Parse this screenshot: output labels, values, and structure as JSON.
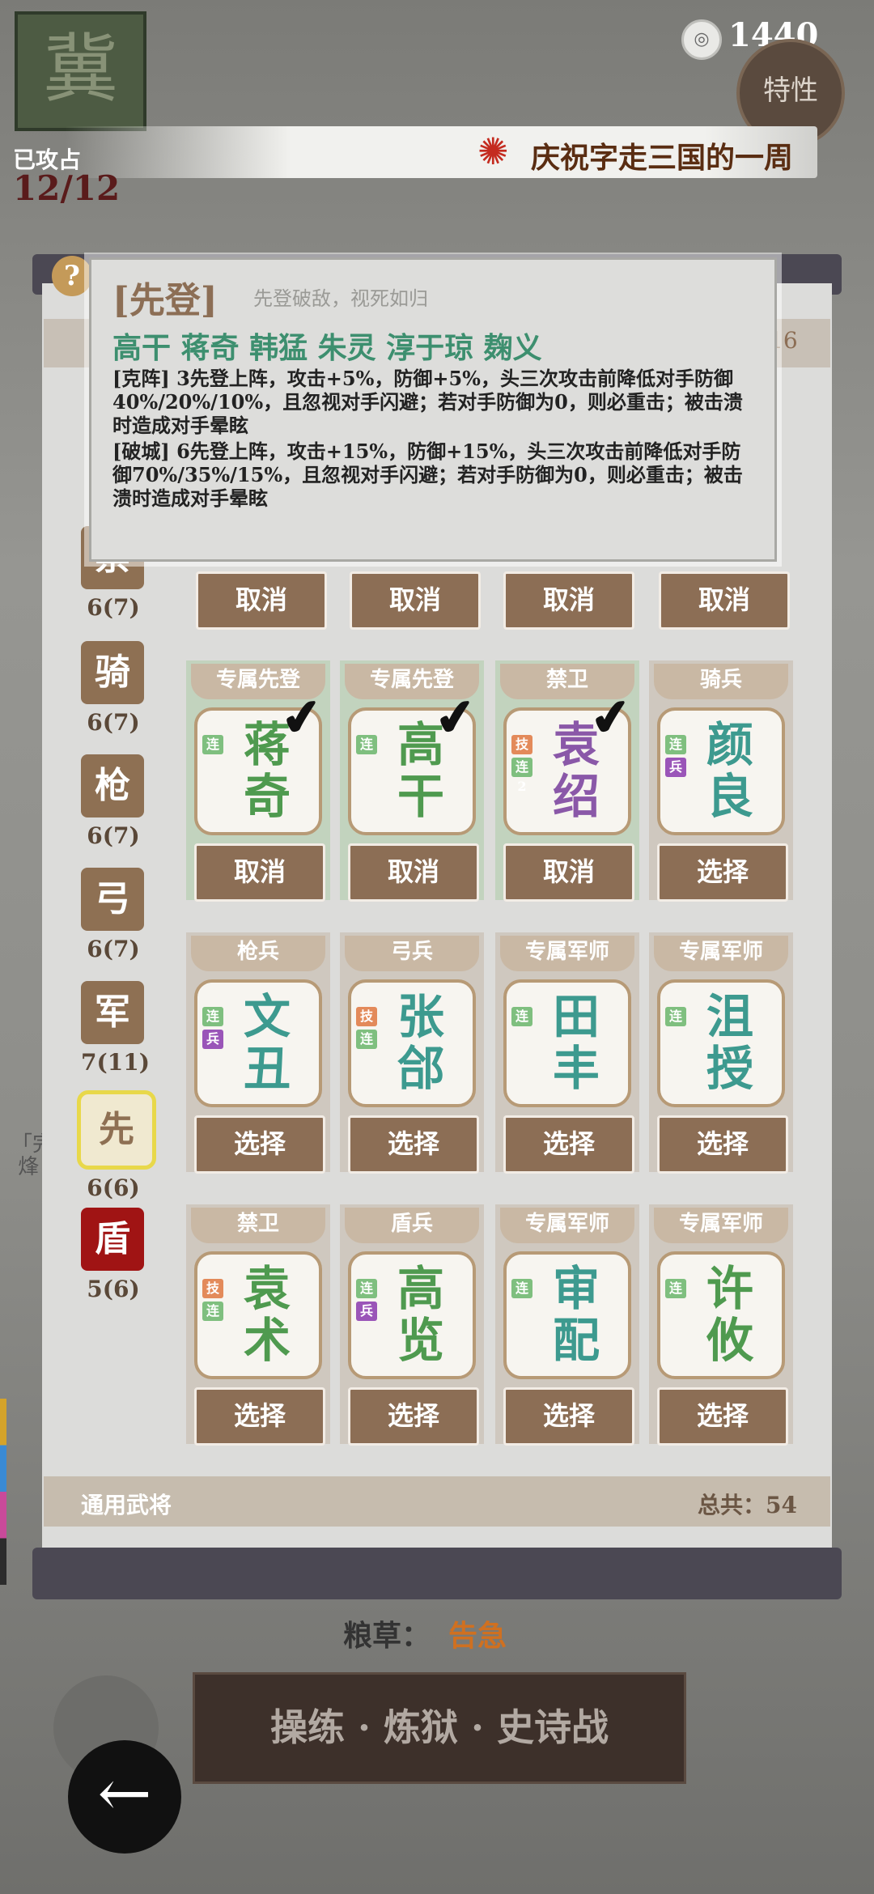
{
  "hud": {
    "city_glyph": "冀",
    "coin_icon": "coin-icon",
    "coin_value": "1440",
    "trait_label": "特性",
    "banner_text": "庆祝字走三国的一周",
    "attacked_label": "已攻占",
    "attacked_count": "12/12",
    "side_quest_text": "「完\n 烽"
  },
  "panel": {
    "help_glyph": "?",
    "top_bar_count": "16",
    "categories": [
      {
        "glyph": "禁",
        "count": "6(7)"
      },
      {
        "glyph": "骑",
        "count": "6(7)"
      },
      {
        "glyph": "枪",
        "count": "6(7)"
      },
      {
        "glyph": "弓",
        "count": "6(7)"
      },
      {
        "glyph": "军",
        "count": "7(11)"
      },
      {
        "glyph": "先",
        "count": "6(6)"
      },
      {
        "glyph": "盾",
        "count": "5(6)"
      }
    ],
    "hidden_row_buttons": [
      "取消",
      "取消",
      "取消",
      "取消"
    ],
    "cards": [
      {
        "tag": "专属先登",
        "name": "蒋奇",
        "badges": [
          "连"
        ],
        "button": "取消"
      },
      {
        "tag": "专属先登",
        "name": "高干",
        "badges": [
          "连"
        ],
        "button": "取消"
      },
      {
        "tag": "禁卫",
        "name": "袁绍",
        "badges": [
          "技",
          "连2"
        ],
        "button": "取消"
      },
      {
        "tag": "骑兵",
        "name": "颜良",
        "badges": [
          "连",
          "兵"
        ],
        "button": "选择"
      },
      {
        "tag": "枪兵",
        "name": "文丑",
        "badges": [
          "连",
          "兵"
        ],
        "button": "选择"
      },
      {
        "tag": "弓兵",
        "name": "张郃",
        "badges": [
          "技",
          "连"
        ],
        "button": "选择"
      },
      {
        "tag": "专属军师",
        "name": "田丰",
        "badges": [
          "连"
        ],
        "button": "选择"
      },
      {
        "tag": "专属军师",
        "name": "沮授",
        "badges": [
          "连"
        ],
        "button": "选择"
      },
      {
        "tag": "禁卫",
        "name": "袁术",
        "badges": [
          "技",
          "连"
        ],
        "button": "选择"
      },
      {
        "tag": "盾兵",
        "name": "高览",
        "badges": [
          "连",
          "兵"
        ],
        "button": "选择"
      },
      {
        "tag": "专属军师",
        "name": "审配",
        "badges": [
          "连"
        ],
        "button": "选择"
      },
      {
        "tag": "专属军师",
        "name": "许攸",
        "badges": [
          "连"
        ],
        "button": "选择"
      }
    ],
    "footer_left": "通用武将",
    "footer_right": "总共：54"
  },
  "tooltip": {
    "title": "[先登]",
    "subtitle": "先登破敌，视死如归",
    "generals": "高干 蒋奇 韩猛 朱灵 淳于琼 麹义",
    "para1": "[克阵] 3先登上阵，攻击+5%，防御+5%，头三次攻击前降低对手防御40%/20%/10%，且忽视对手闪避；若对手防御为0，则必重击；被击溃时造成对手晕眩",
    "para2": "[破城] 6先登上阵，攻击+15%，防御+15%，头三次攻击前降低对手防御70%/35%/15%，且忽视对手闪避；若对手防御为0，则必重击；被击溃时造成对手晕眩"
  },
  "bottom": {
    "grain_label": "粮草：",
    "grain_status": "告急",
    "battle_button": "操练 · 炼狱 · 史诗战",
    "back_icon": "back-arrow-icon"
  },
  "colors": {
    "accent_brown": "#8c6e55",
    "selected_green": "#c2d3be",
    "tooltip_green": "#3d8f6f",
    "alert_orange": "#d07020"
  }
}
